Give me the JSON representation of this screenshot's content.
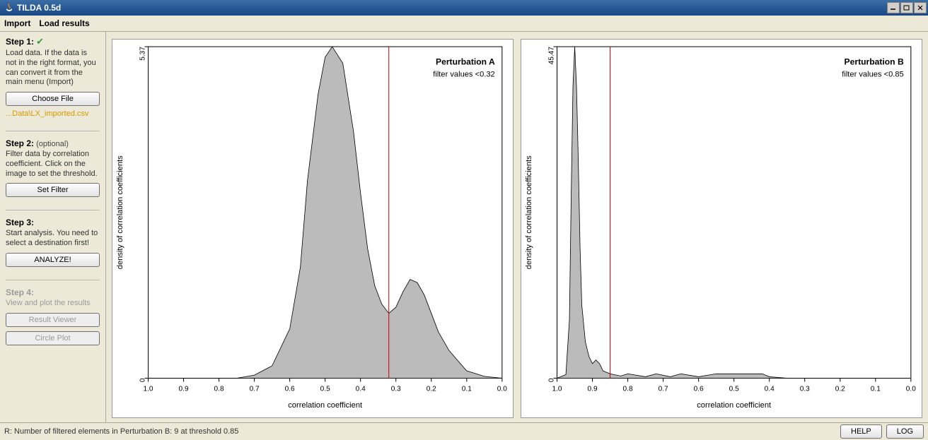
{
  "window": {
    "title": "TILDA 0.5d"
  },
  "menu": {
    "import": "Import",
    "load_results": "Load results"
  },
  "sidebar": {
    "step1": {
      "title": "Step 1:",
      "ok": true,
      "text": "Load data. If the data is not in the right format, you can convert it from the main menu (Import)",
      "button": "Choose File",
      "file": "...Data\\LX_imported.csv"
    },
    "step2": {
      "title": "Step 2:",
      "opt": "(optional)",
      "text": "Filter data by correlation coefficient. Click on the image to set the threshold.",
      "button": "Set Filter"
    },
    "step3": {
      "title": "Step 3:",
      "text": "Start analysis. You need to select a destination first!",
      "button": "ANALYZE!"
    },
    "step4": {
      "title": "Step 4:",
      "text": "View and plot the results",
      "button1": "Result Viewer",
      "button2": "Circle Plot"
    }
  },
  "status": {
    "message": "R: Number of filtered elements in Perturbation B: 9 at threshold 0.85",
    "help": "HELP",
    "log": "LOG"
  },
  "chart_data": [
    {
      "type": "area",
      "title": "Perturbation A",
      "subtitle": "filter values <0.32",
      "xlabel": "correlation coefficient",
      "ylabel": "density of correlation coefficients",
      "xlim": [
        1.0,
        0.0
      ],
      "ylim": [
        0.0,
        5.37
      ],
      "threshold": 0.32,
      "x_ticks": [
        1.0,
        0.9,
        0.8,
        0.7,
        0.6,
        0.5,
        0.4,
        0.3,
        0.2,
        0.1,
        0.0
      ],
      "y_ticks": [
        0.0,
        5.37
      ],
      "series": [
        {
          "name": "density",
          "x": [
            1.0,
            0.75,
            0.7,
            0.65,
            0.6,
            0.57,
            0.55,
            0.52,
            0.5,
            0.48,
            0.45,
            0.42,
            0.4,
            0.38,
            0.36,
            0.34,
            0.32,
            0.3,
            0.28,
            0.26,
            0.24,
            0.22,
            0.2,
            0.18,
            0.15,
            0.12,
            0.1,
            0.05,
            0.0
          ],
          "values": [
            0.0,
            0.0,
            0.05,
            0.2,
            0.8,
            1.8,
            3.2,
            4.6,
            5.2,
            5.37,
            5.1,
            4.0,
            3.0,
            2.1,
            1.5,
            1.2,
            1.05,
            1.15,
            1.4,
            1.6,
            1.55,
            1.35,
            1.05,
            0.75,
            0.45,
            0.25,
            0.12,
            0.03,
            0.0
          ]
        }
      ]
    },
    {
      "type": "area",
      "title": "Perturbation B",
      "subtitle": "filter values <0.85",
      "xlabel": "correlation coefficient",
      "ylabel": "density of correlation coefficients",
      "xlim": [
        1.0,
        0.0
      ],
      "ylim": [
        0.0,
        45.47
      ],
      "threshold": 0.85,
      "x_ticks": [
        1.0,
        0.9,
        0.8,
        0.7,
        0.6,
        0.5,
        0.4,
        0.3,
        0.2,
        0.1,
        0.0
      ],
      "y_ticks": [
        0.0,
        45.47
      ],
      "series": [
        {
          "name": "density",
          "x": [
            1.0,
            0.975,
            0.965,
            0.96,
            0.955,
            0.95,
            0.945,
            0.94,
            0.935,
            0.93,
            0.92,
            0.91,
            0.9,
            0.89,
            0.88,
            0.87,
            0.86,
            0.85,
            0.82,
            0.8,
            0.75,
            0.72,
            0.68,
            0.65,
            0.6,
            0.55,
            0.5,
            0.45,
            0.42,
            0.4,
            0.35,
            0.0
          ],
          "values": [
            0.0,
            0.5,
            8.0,
            25.0,
            40.0,
            45.47,
            40.0,
            30.0,
            18.0,
            10.0,
            5.0,
            3.0,
            2.0,
            2.5,
            2.0,
            1.0,
            0.8,
            0.6,
            0.3,
            0.6,
            0.2,
            0.6,
            0.2,
            0.6,
            0.2,
            0.6,
            0.6,
            0.6,
            0.6,
            0.2,
            0.0,
            0.0
          ]
        }
      ]
    }
  ]
}
